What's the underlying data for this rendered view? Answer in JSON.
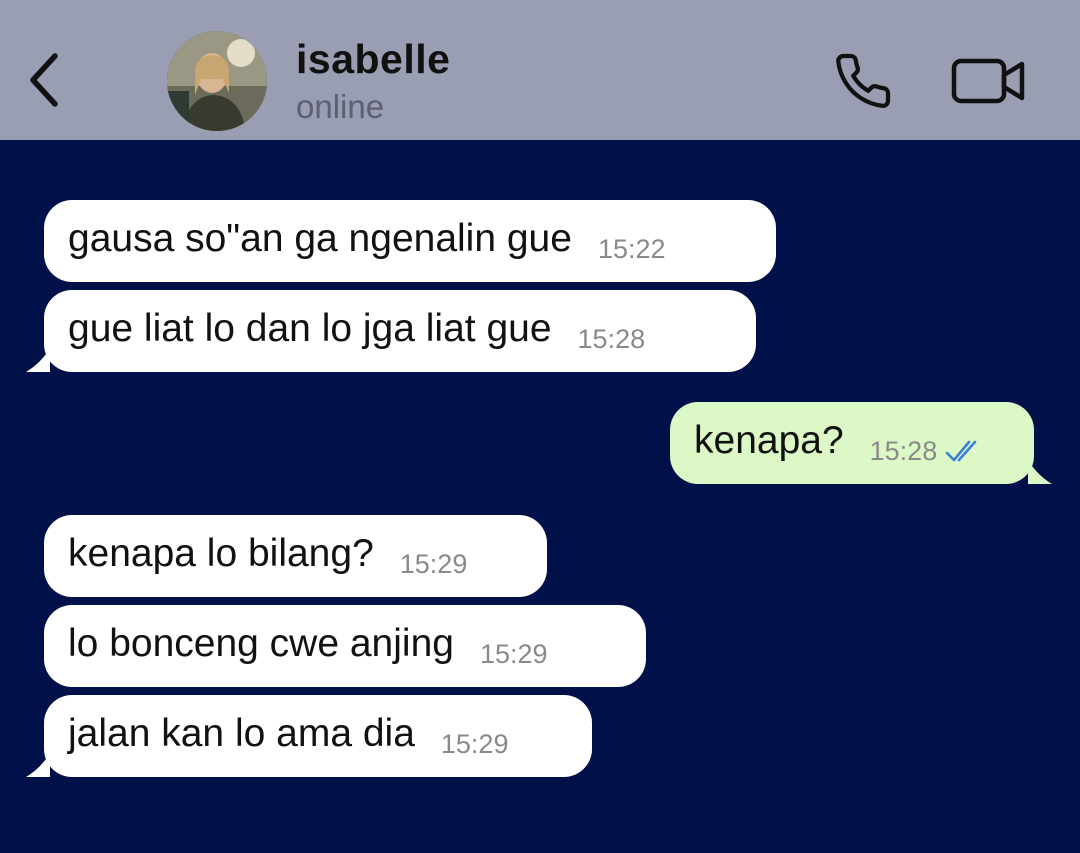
{
  "header": {
    "contact_name": "isabelle",
    "contact_status": "online",
    "back_icon": "chevron-left-icon",
    "call_icon": "phone-icon",
    "video_icon": "video-camera-icon"
  },
  "colors": {
    "header_bg": "#9a9eb3",
    "chat_bg": "#001048",
    "incoming_bubble": "#ffffff",
    "outgoing_bubble": "#dcf8c6",
    "read_ticks": "#3b82d6"
  },
  "messages": [
    {
      "direction": "incoming",
      "text": "gausa so\"an ga ngenalin gue",
      "time": "15:22"
    },
    {
      "direction": "incoming",
      "text": "gue liat lo dan lo jga liat gue",
      "time": "15:28"
    },
    {
      "direction": "outgoing",
      "text": "kenapa?",
      "time": "15:28",
      "status": "read"
    },
    {
      "direction": "incoming",
      "text": "kenapa lo bilang?",
      "time": "15:29"
    },
    {
      "direction": "incoming",
      "text": "lo bonceng cwe anjing",
      "time": "15:29"
    },
    {
      "direction": "incoming",
      "text": "jalan kan lo ama dia",
      "time": "15:29"
    }
  ]
}
